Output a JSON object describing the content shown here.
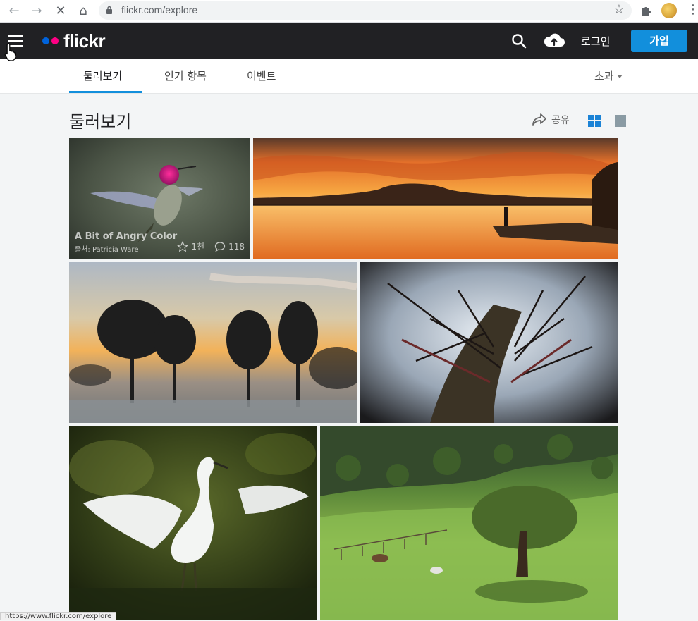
{
  "browser": {
    "url": "flickr.com/explore",
    "status_url": "https://www.flickr.com/explore"
  },
  "header": {
    "logo_text": "flickr",
    "login_label": "로그인",
    "signup_label": "가입",
    "colors": {
      "bg": "#212124",
      "accent": "#128fdc",
      "blue_dot": "#0063dc",
      "pink_dot": "#ff0084"
    }
  },
  "subnav": {
    "tabs": [
      {
        "label": "둘러보기",
        "active": true
      },
      {
        "label": "인기 항목",
        "active": false
      },
      {
        "label": "이벤트",
        "active": false
      }
    ],
    "more_label": "초과"
  },
  "page": {
    "title": "둘러보기",
    "share_label": "공유"
  },
  "photos": [
    {
      "title": "A Bit of Angry Color",
      "author": "출처: Patricia Ware",
      "faves": "1천",
      "comments": "118",
      "subject": "hummingbird"
    },
    {
      "subject": "sunset-lake"
    },
    {
      "subject": "misty-trees-sunrise"
    },
    {
      "subject": "thorny-branch"
    },
    {
      "subject": "egret"
    },
    {
      "subject": "green-hillside"
    }
  ]
}
